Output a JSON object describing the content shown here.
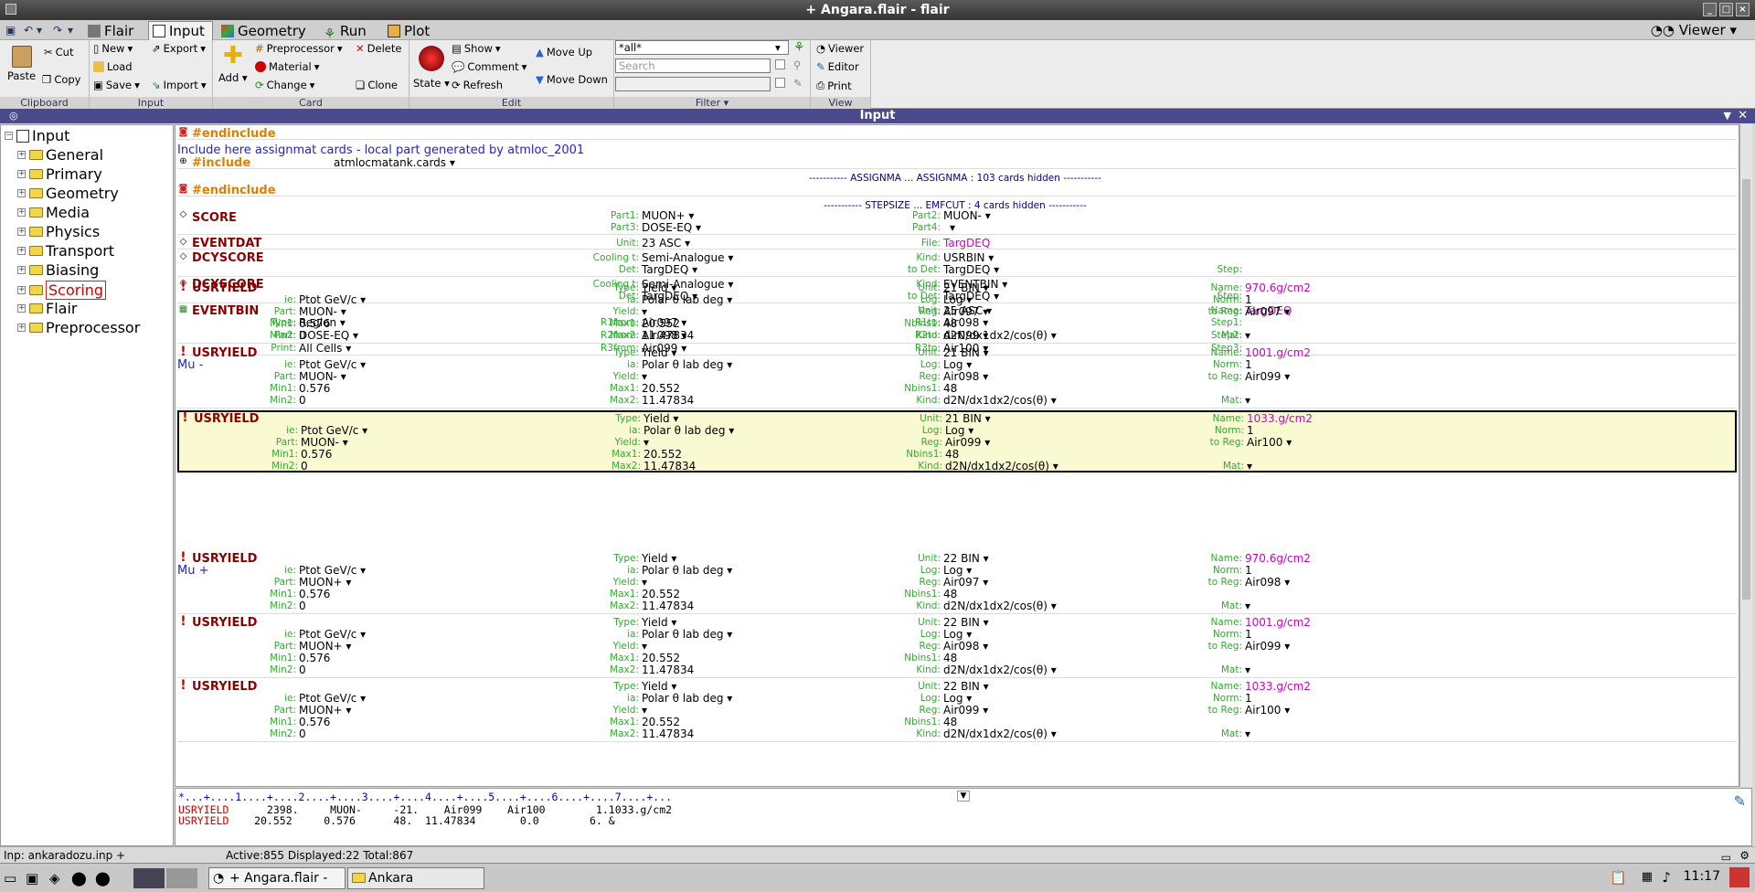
{
  "window_title": "+ Angara.flair - flair",
  "tabs": [
    "Flair",
    "Input",
    "Geometry",
    "Run",
    "Plot"
  ],
  "viewer_label": "Viewer",
  "ribbon": {
    "clipboard": {
      "paste": "Paste",
      "cut": "Cut",
      "copy": "Copy",
      "label": "Clipboard"
    },
    "input": {
      "new": "New",
      "load": "Load",
      "save": "Save",
      "export": "Export",
      "import": "Import",
      "label": "Input"
    },
    "card": {
      "add": "Add",
      "preprocessor": "Preprocessor",
      "material": "Material",
      "change": "Change",
      "delete": "Delete",
      "clone": "Clone",
      "label": "Card"
    },
    "edit": {
      "state": "State",
      "show": "Show",
      "comment": "Comment",
      "refresh": "Refresh",
      "move_up": "Move Up",
      "move_down": "Move Down",
      "label": "Edit"
    },
    "filter": {
      "value": "*all*",
      "search_placeholder": "Search",
      "label": "Filter"
    },
    "view": {
      "viewer": "Viewer",
      "editor": "Editor",
      "print": "Print",
      "label": "View"
    }
  },
  "panel_title": "Input",
  "tree": {
    "root": "Input",
    "items": [
      "General",
      "Primary",
      "Geometry",
      "Media",
      "Physics",
      "Transport",
      "Biasing",
      "Scoring",
      "Flair",
      "Preprocessor"
    ],
    "selected": "Scoring"
  },
  "editor": {
    "endinclude": "#endinclude",
    "comment_assignmat": "Include here assignmat cards - local part generated by atmloc_2001",
    "include": "#include",
    "include_file": "atmlocmatank.cards ▾",
    "hidden_assignma": "----------- ASSIGNMA ... ASSIGNMA : 103 cards hidden -----------",
    "hidden_stepsize": "----------- STEPSIZE ... EMFCUT : 4 cards hidden -----------",
    "score": {
      "name": "SCORE",
      "part1": "MUON+ ▾",
      "part2": "MUON- ▾",
      "part3": "DOSE-EQ ▾",
      "part4": "▾"
    },
    "eventdat": {
      "name": "EVENTDAT",
      "unit": "23 ASC ▾",
      "file": "TargDEQ"
    },
    "dcyscore1": {
      "name": "DCYSCORE",
      "cooling": "Semi-Analogue ▾",
      "kind": "USRBIN ▾",
      "det": "TargDEQ ▾",
      "todet": "TargDEQ ▾"
    },
    "dcyscore2": {
      "name": "DCYSCORE",
      "cooling": "Semi-Analogue ▾",
      "kind": "EVENTBIN ▾",
      "det": "TargDEQ ▾",
      "todet": "TargDEQ ▾"
    },
    "eventbin": {
      "name": "EVENTBIN",
      "unit": "25 ASC ▾",
      "bname": "TargDEQ",
      "type": "Region ▾",
      "part": "DOSE-EQ ▾",
      "print": "All Cells ▾",
      "r1from": "Air097 ▾",
      "r2from": "Air098 ▾",
      "r3from": "Air099 ▾",
      "r1to": "Air098 ▾",
      "r2to": "Air099 ▾",
      "r3to": "Air100 ▾"
    },
    "comment_mu_minus": "Mu -",
    "comment_mu_plus": "Mu +",
    "usryield": [
      {
        "name": "USRYIELD",
        "type": "Yield ▾",
        "unit": "21 BIN ▾",
        "yname": "970.6g/cm2",
        "ie": "Ptot GeV/c ▾",
        "ia": "Polar θ lab deg ▾",
        "log": "Log ▾",
        "norm": "1",
        "part": "MUON- ▾",
        "yield": "▾",
        "reg": "Air097 ▾",
        "toreg": "Air097 ▾",
        "min1": "0.576",
        "max1": "20.552",
        "nbins1": "48",
        "min2": "0",
        "max2": "11.47834",
        "kind": "d2N/dx1dx2/cos(θ) ▾",
        "mat": "▾"
      },
      {
        "name": "USRYIELD",
        "type": "Yield ▾",
        "unit": "21 BIN ▾",
        "yname": "1001.g/cm2",
        "ie": "Ptot GeV/c ▾",
        "ia": "Polar θ lab deg ▾",
        "log": "Log ▾",
        "norm": "1",
        "part": "MUON- ▾",
        "yield": "▾",
        "reg": "Air098 ▾",
        "toreg": "Air099 ▾",
        "min1": "0.576",
        "max1": "20.552",
        "nbins1": "48",
        "min2": "0",
        "max2": "11.47834",
        "kind": "d2N/dx1dx2/cos(θ) ▾",
        "mat": "▾"
      },
      {
        "name": "USRYIELD",
        "type": "Yield ▾",
        "unit": "21 BIN ▾",
        "yname": "1033.g/cm2",
        "ie": "Ptot GeV/c ▾",
        "ia": "Polar θ lab deg ▾",
        "log": "Log ▾",
        "norm": "1",
        "part": "MUON- ▾",
        "yield": "▾",
        "reg": "Air099 ▾",
        "toreg": "Air100 ▾",
        "min1": "0.576",
        "max1": "20.552",
        "nbins1": "48",
        "min2": "0",
        "max2": "11.47834",
        "kind": "d2N/dx1dx2/cos(θ) ▾",
        "mat": "▾"
      },
      {
        "name": "USRYIELD",
        "type": "Yield ▾",
        "unit": "22 BIN ▾",
        "yname": "970.6g/cm2",
        "ie": "Ptot GeV/c ▾",
        "ia": "Polar θ lab deg ▾",
        "log": "Log ▾",
        "norm": "1",
        "part": "MUON+ ▾",
        "yield": "▾",
        "reg": "Air097 ▾",
        "toreg": "Air098 ▾",
        "min1": "0.576",
        "max1": "20.552",
        "nbins1": "48",
        "min2": "0",
        "max2": "11.47834",
        "kind": "d2N/dx1dx2/cos(θ) ▾",
        "mat": "▾"
      },
      {
        "name": "USRYIELD",
        "type": "Yield ▾",
        "unit": "22 BIN ▾",
        "yname": "1001.g/cm2",
        "ie": "Ptot GeV/c ▾",
        "ia": "Polar θ lab deg ▾",
        "log": "Log ▾",
        "norm": "1",
        "part": "MUON+ ▾",
        "yield": "▾",
        "reg": "Air098 ▾",
        "toreg": "Air099 ▾",
        "min1": "0.576",
        "max1": "20.552",
        "nbins1": "48",
        "min2": "0",
        "max2": "11.47834",
        "kind": "d2N/dx1dx2/cos(θ) ▾",
        "mat": "▾"
      },
      {
        "name": "USRYIELD",
        "type": "Yield ▾",
        "unit": "22 BIN ▾",
        "yname": "1033.g/cm2",
        "ie": "Ptot GeV/c ▾",
        "ia": "Polar θ lab deg ▾",
        "log": "Log ▾",
        "norm": "1",
        "part": "MUON+ ▾",
        "yield": "▾",
        "reg": "Air099 ▾",
        "toreg": "Air100 ▾",
        "min1": "0.576",
        "max1": "20.552",
        "nbins1": "48",
        "min2": "0",
        "max2": "11.47834",
        "kind": "d2N/dx1dx2/cos(θ) ▾",
        "mat": "▾"
      }
    ],
    "labels": {
      "part1": "Part1:",
      "part2": "Part2:",
      "part3": "Part3:",
      "part4": "Part4:",
      "unit": "Unit:",
      "file": "File:",
      "cooling": "Cooling t:",
      "kind": "Kind:",
      "step": "Step:",
      "det": "Det:",
      "todet": "to Det:",
      "name": "Name:",
      "type": "Type:",
      "part": "Part:",
      "print": "Print:",
      "r1from": "R1from:",
      "r2from": "R2from:",
      "r3from": "R3from:",
      "r1to": "R1to:",
      "r2to": "R2to:",
      "r3to": "R3to:",
      "step1": "Step1:",
      "step2": "Step2:",
      "step3": "Step3:",
      "ie": "ie:",
      "ia": "ia:",
      "log": "Log:",
      "norm": "Norm:",
      "yield": "Yield:",
      "reg": "Reg:",
      "toreg": "to Reg:",
      "min1": "Min1:",
      "max1": "Max1:",
      "nbins1": "Nbins1:",
      "min2": "Min2:",
      "max2": "Max2:",
      "mat": "Mat:"
    }
  },
  "text_view": {
    "ruler": "*...+....1....+....2....+....3....+....4....+....5....+....6....+....7....+...",
    "line1_name": "USRYIELD",
    "line1": "      2398.     MUON-     -21.    Air099    Air100        1.1033.g/cm2",
    "line2_name": "USRYIELD",
    "line2": "    20.552     0.576      48.  11.47834       0.0        6. &"
  },
  "status": {
    "file": "Inp: ankaradozu.inp +",
    "counts": "Active:855  Displayed:22 Total:867"
  },
  "taskbar": {
    "task1": "+ Angara.flair - fl...",
    "task2": "Ankara",
    "clock": "11:17"
  }
}
